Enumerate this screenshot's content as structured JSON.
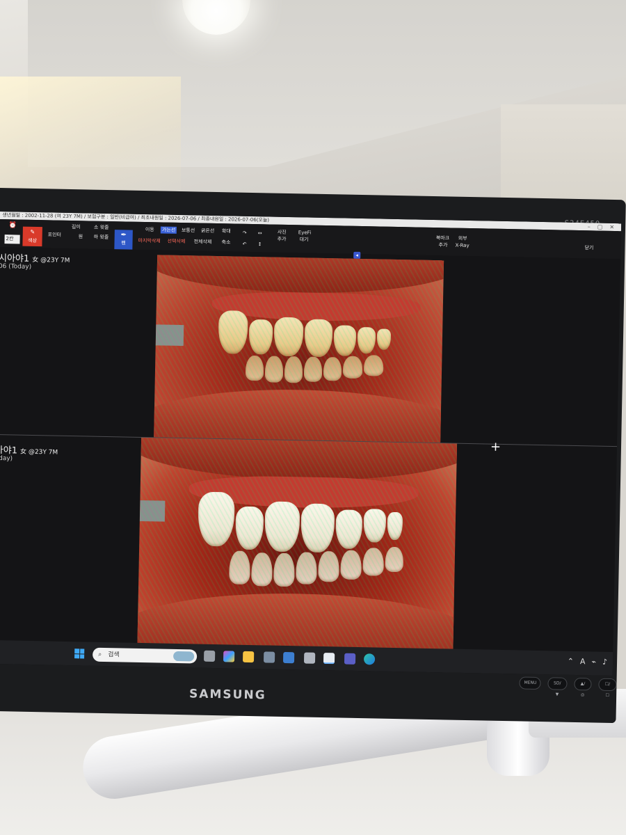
{
  "monitor": {
    "model": "S24E450",
    "brand": "SAMSUNG",
    "buttons": [
      "MENU",
      "SD/▼",
      "▲/◎",
      "☐/☐",
      "⏻"
    ]
  },
  "window": {
    "info_bar": "생년월일 : 2002-11-28 (여 23Y 7M) / 보험구분 : 일반(비급여) / 최초내원일 : 2026-07-06 / 최종내원일 : 2026-07-06(오늘)",
    "controls": [
      "–",
      "▢",
      "✕"
    ]
  },
  "toolbar": {
    "grid_select": "2칸",
    "color_label": "색상",
    "pointer": "포인터",
    "line": "길이",
    "circle": "원",
    "up_tooth": "소 윗줄",
    "down_tooth": "하 윗줄",
    "pen": "펜",
    "move": "이동",
    "thin_line": "가는선",
    "normal_line": "보통선",
    "thick_line": "굵은선",
    "zoom_in": "확대",
    "zoom_out": "축소",
    "delete_last": "마지막삭제",
    "delete_selected": "선택삭제",
    "delete_all": "전체삭제",
    "rotate_right": "↷",
    "rotate_left": "↶",
    "flip_h": "↔",
    "flip_v": "↕",
    "photo_add_1": "사진",
    "photo_add_2": "추가",
    "eyefi_1": "EyeFi",
    "eyefi_2": "대기",
    "bookmark_1": "북마크",
    "bookmark_2": "추가",
    "xray_1": "외부",
    "xray_2": "X-Ray",
    "close": "닫기"
  },
  "panes": [
    {
      "name": "시아야1",
      "meta": "女 @23Y 7M",
      "date": "06 (Today)"
    },
    {
      "name": "아야1",
      "meta": "女 @23Y 7M",
      "date": "oday)"
    }
  ],
  "taskbar": {
    "search_placeholder": "검색",
    "tray_letter": "A"
  },
  "colors": {
    "accent_red": "#d93a2a",
    "accent_blue": "#3a62d8"
  }
}
